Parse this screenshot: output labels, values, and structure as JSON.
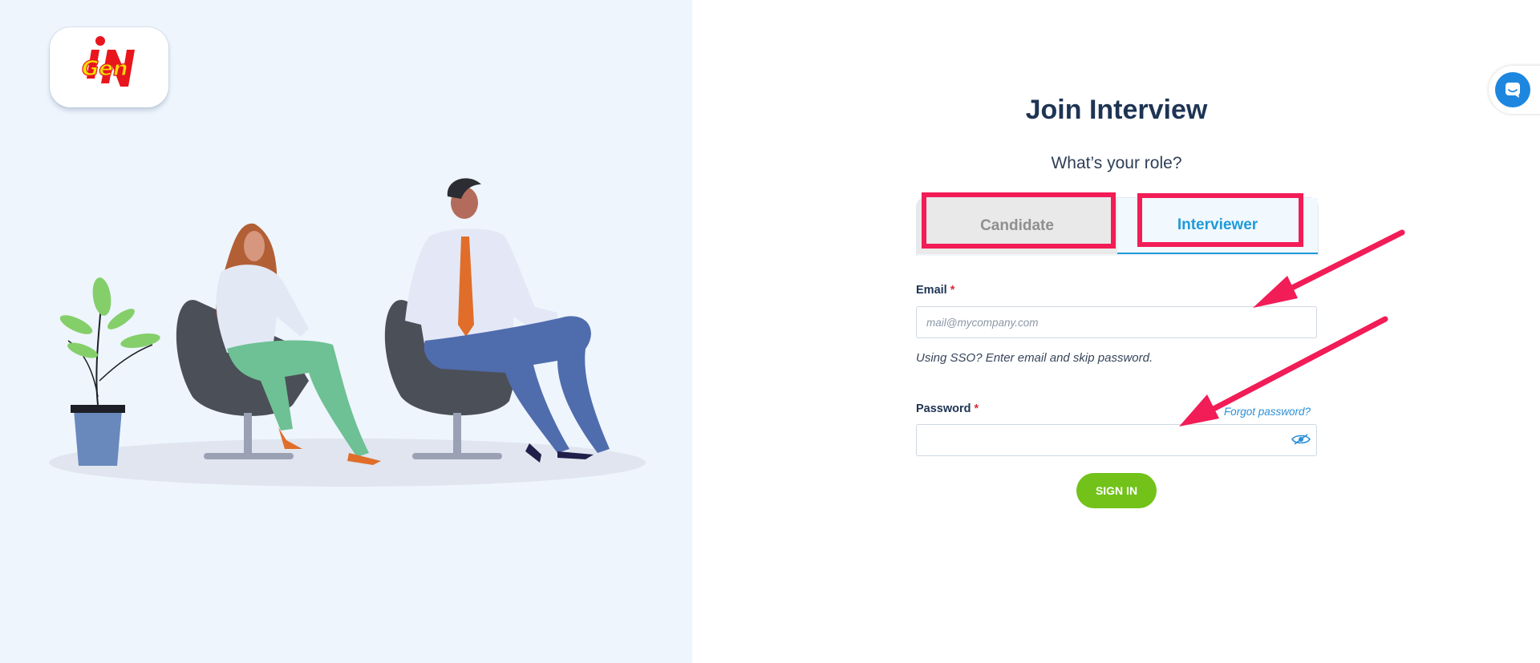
{
  "brand": {
    "logo_text_top": "IN",
    "logo_text_mid": "Gen"
  },
  "form": {
    "title": "Join Interview",
    "role_question": "What’s your role?",
    "tabs": [
      {
        "label": "Candidate",
        "selected": false
      },
      {
        "label": "Interviewer",
        "selected": true
      }
    ],
    "email": {
      "label": "Email",
      "required_mark": "*",
      "placeholder": "mail@mycompany.com",
      "value": ""
    },
    "sso_hint": "Using SSO? Enter email and skip password.",
    "password": {
      "label": "Password",
      "required_mark": "*",
      "value": ""
    },
    "forgot_password": "Forgot password?",
    "submit": "SIGN IN"
  },
  "colors": {
    "left_panel_bg": "#eef5fd",
    "accent_blue": "#1f9ad8",
    "submit_green": "#72c21a",
    "annotation_red": "#f21c57",
    "title_navy": "#1e3454"
  },
  "icons": {
    "eye": "eye-icon",
    "chat": "chat-icon",
    "annotation_arrow": "arrow-icon"
  }
}
